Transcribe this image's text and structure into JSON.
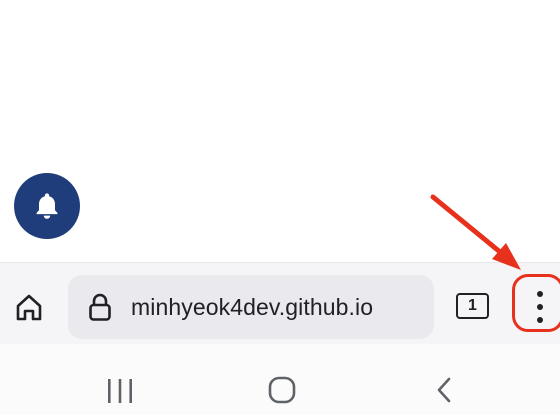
{
  "browser": {
    "url": "minhyeok4dev.github.io",
    "tab_count": "1"
  },
  "page": {
    "fab_icon": "bell-icon",
    "fab_color": "#1f3d7a"
  },
  "annotation": {
    "color": "#e8311d",
    "target": "menu-button"
  },
  "navbar": {
    "icons": [
      "recent-apps-icon",
      "home-icon",
      "back-icon"
    ]
  }
}
